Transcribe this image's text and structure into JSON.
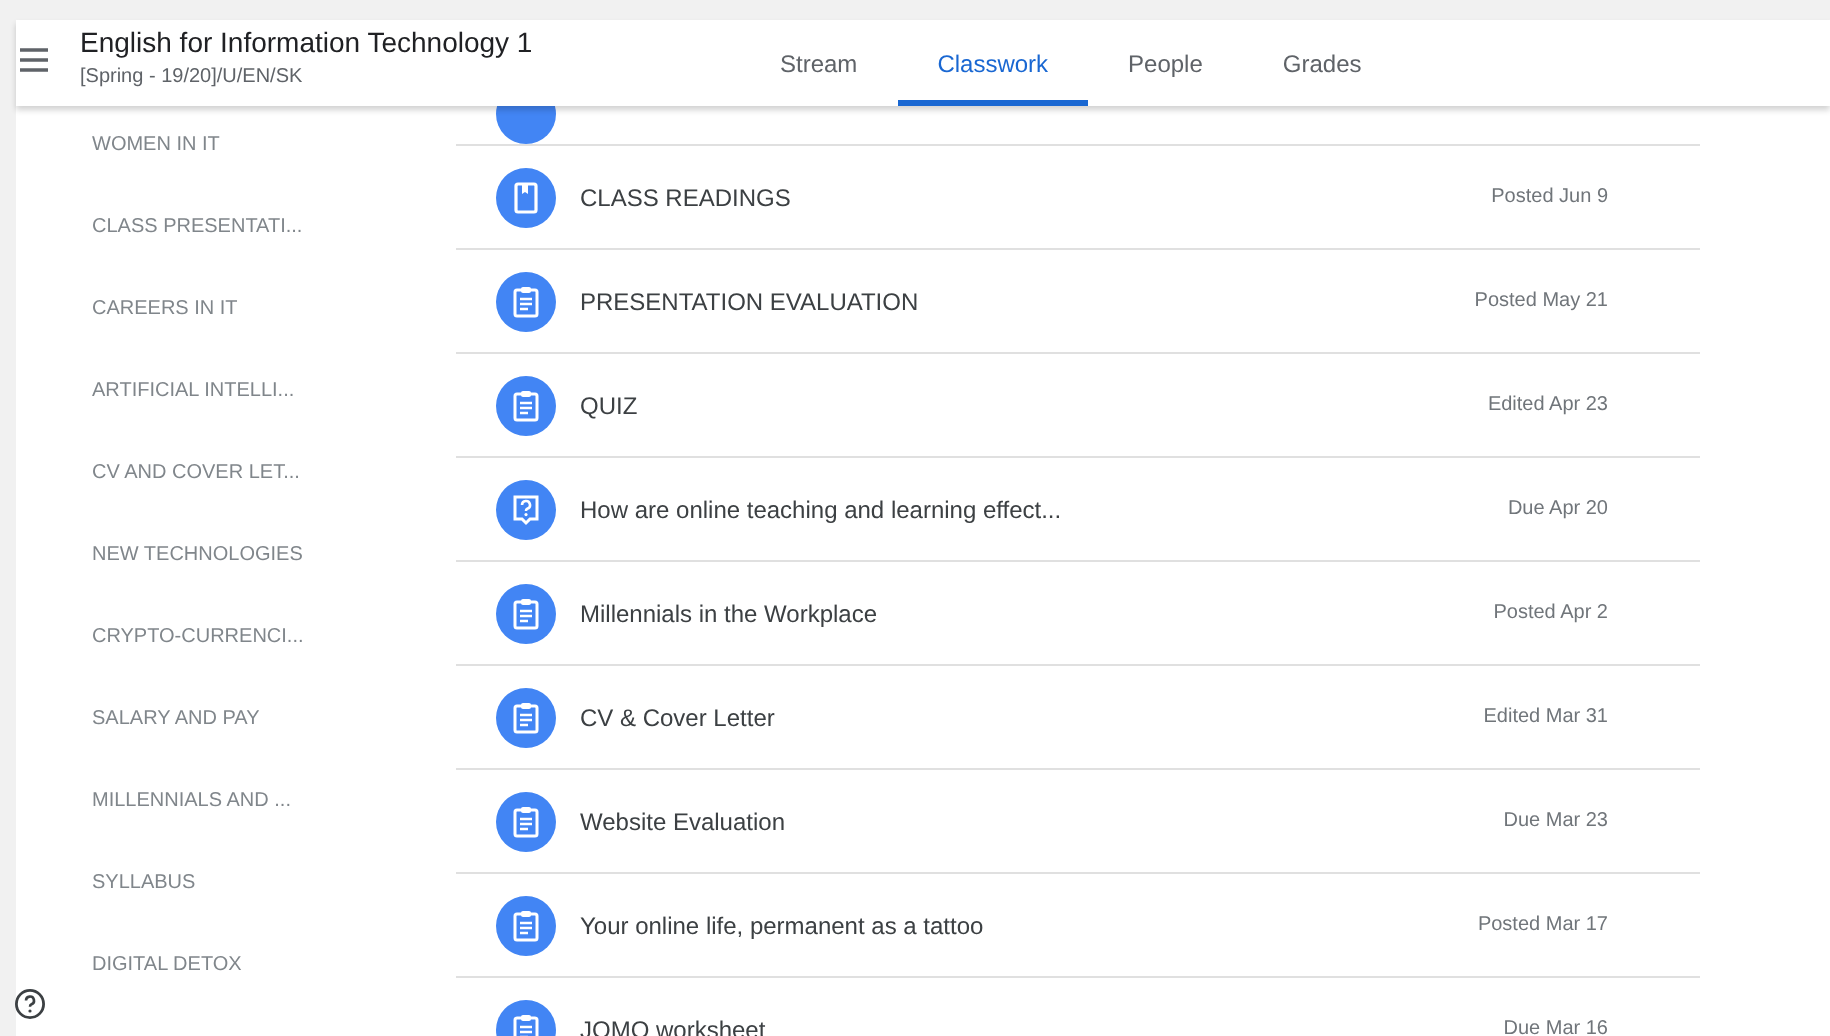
{
  "header": {
    "title": "English for Information Technology 1",
    "subtitle": "[Spring - 19/20]/U/EN/SK"
  },
  "tabs": [
    {
      "label": "Stream",
      "selected": false
    },
    {
      "label": "Classwork",
      "selected": true
    },
    {
      "label": "People",
      "selected": false
    },
    {
      "label": "Grades",
      "selected": false
    }
  ],
  "topics": [
    "WOMEN IN IT",
    "CLASS PRESENTATI...",
    "CAREERS IN IT",
    "ARTIFICIAL INTELLI...",
    "CV AND COVER LET...",
    "NEW TECHNOLOGIES",
    "CRYPTO-CURRENCI...",
    "SALARY AND PAY",
    "MILLENNIALS AND ...",
    "SYLLABUS",
    "DIGITAL DETOX"
  ],
  "items": [
    {
      "kind": "material",
      "title": "CLASS READINGS",
      "date": "Posted Jun 9"
    },
    {
      "kind": "assignment",
      "title": "PRESENTATION EVALUATION",
      "date": "Posted May 21"
    },
    {
      "kind": "assignment",
      "title": "QUIZ",
      "date": "Edited Apr 23"
    },
    {
      "kind": "question",
      "title": "How are online teaching and learning effect...",
      "date": "Due Apr 20"
    },
    {
      "kind": "assignment",
      "title": "Millennials in the Workplace",
      "date": "Posted Apr 2"
    },
    {
      "kind": "assignment",
      "title": "CV & Cover Letter",
      "date": "Edited Mar 31"
    },
    {
      "kind": "assignment",
      "title": "Website Evaluation",
      "date": "Due Mar 23"
    },
    {
      "kind": "assignment",
      "title": "Your online life, permanent as a tattoo",
      "date": "Posted Mar 17"
    },
    {
      "kind": "assignment",
      "title": "JOMO worksheet",
      "date": "Due Mar 16"
    }
  ]
}
